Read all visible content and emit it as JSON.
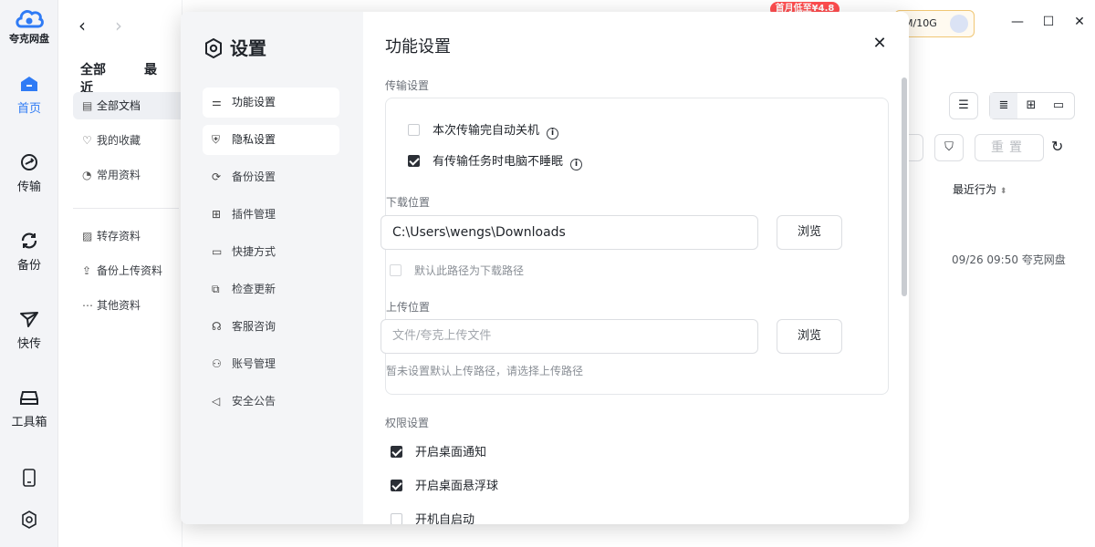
{
  "app": {
    "logo_text": "夸克网盘"
  },
  "rail": {
    "items": [
      {
        "label": "首页",
        "icon": "home-icon"
      },
      {
        "label": "传输",
        "icon": "transfer-icon"
      },
      {
        "label": "备份",
        "icon": "backup-icon"
      },
      {
        "label": "快传",
        "icon": "send-icon"
      },
      {
        "label": "工具箱",
        "icon": "toolbox-icon"
      }
    ]
  },
  "nav": {
    "tabs": [
      "全部",
      "最近"
    ],
    "items": [
      {
        "label": "全部文档",
        "icon": "document-icon"
      },
      {
        "label": "我的收藏",
        "icon": "heart-icon"
      },
      {
        "label": "常用资料",
        "icon": "clock-icon"
      },
      {
        "label": "转存资料",
        "icon": "save-icon"
      },
      {
        "label": "备份上传资料",
        "icon": "upload-icon"
      },
      {
        "label": "其他资料",
        "icon": "more-icon"
      }
    ]
  },
  "header": {
    "promo": "首月低至¥4.8",
    "quota": "M/10G"
  },
  "toolbar": {
    "reset_label": "重置"
  },
  "list": {
    "column_recent": "最近行为",
    "row_meta": "09/26 09:50 夸克网盘"
  },
  "settings": {
    "title": "设置",
    "menu": [
      {
        "label": "功能设置",
        "icon": "sliders-icon"
      },
      {
        "label": "隐私设置",
        "icon": "shield-icon"
      },
      {
        "label": "备份设置",
        "icon": "sync-icon"
      },
      {
        "label": "插件管理",
        "icon": "grid-icon"
      },
      {
        "label": "快捷方式",
        "icon": "shortcut-icon"
      },
      {
        "label": "检查更新",
        "icon": "update-icon"
      },
      {
        "label": "客服咨询",
        "icon": "headset-icon"
      },
      {
        "label": "账号管理",
        "icon": "user-gear-icon"
      },
      {
        "label": "安全公告",
        "icon": "megaphone-icon"
      }
    ],
    "content": {
      "title": "功能设置",
      "transfer_section": "传输设置",
      "auto_shutdown": {
        "label": "本次传输完自动关机",
        "checked": false
      },
      "no_sleep": {
        "label": "有传输任务时电脑不睡眠",
        "checked": true
      },
      "download_label": "下载位置",
      "download_path": "C:\\Users\\wengs\\Downloads",
      "browse_label": "浏览",
      "default_download": {
        "label": "默认此路径为下载路径",
        "checked": false
      },
      "upload_label": "上传位置",
      "upload_placeholder": "文件/夸克上传文件",
      "upload_hint": "暂未设置默认上传路径，请选择上传路径",
      "permission_section": "权限设置",
      "desktop_notify": {
        "label": "开启桌面通知",
        "checked": true
      },
      "float_ball": {
        "label": "开启桌面悬浮球",
        "checked": true
      },
      "auto_start": {
        "label": "开机自启动",
        "checked": false
      }
    }
  }
}
